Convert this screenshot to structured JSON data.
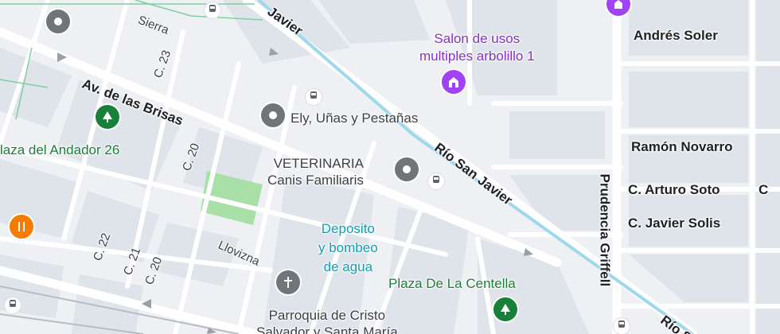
{
  "map": {
    "colors": {
      "background": "#eef0f3",
      "block": "#dfe3ea",
      "road": "#ffffff",
      "river": "#9ed8ec",
      "park": "#a8e0a8",
      "poi_grey": "#70757a",
      "poi_green": "#188038",
      "poi_purple": "#a142f4",
      "poi_food": "#f57c00"
    },
    "streets": {
      "av_brisas": "Av. de las Brisas",
      "sierra": "Sierra",
      "c23": "C. 23",
      "c20a": "C. 20",
      "c22": "C. 22",
      "c21": "C. 21",
      "c20b": "C. 20",
      "llovizna": "Llovizna",
      "rio_san_javier_top": "Javier",
      "rio_san_javier_mid": "Río San Javier",
      "rio_san_javier_bottom": "Río S",
      "prudencia_griffell": "Prudencia Griffell",
      "andres_soler": "Andrés Soler",
      "ramon_novarro": "Ramón Novarro",
      "arturo_soto": "C. Arturo Soto",
      "javier_solis": "C. Javier Solis",
      "c_right": "C"
    },
    "pois": {
      "salon": "Salon de usos\nmultiples arbolillo 1",
      "ely": "Ely, Uñas y Pestañas",
      "veterinaria": "VETERINARIA\nCanis Familiaris",
      "plaza_andador": "laza del Andador 26",
      "deposito": "Deposito\ny bombeo\nde agua",
      "plaza_centella": "Plaza De La Centella",
      "parroquia": "Parroquia de Cristo\nSalvador y Santa María"
    },
    "icons": {
      "pin_grey": "place-pin-icon",
      "park": "park-tree-icon",
      "worship": "church-cross-icon",
      "venue": "venue-icon",
      "food": "restaurant-icon",
      "transit": "bus-icon"
    }
  }
}
